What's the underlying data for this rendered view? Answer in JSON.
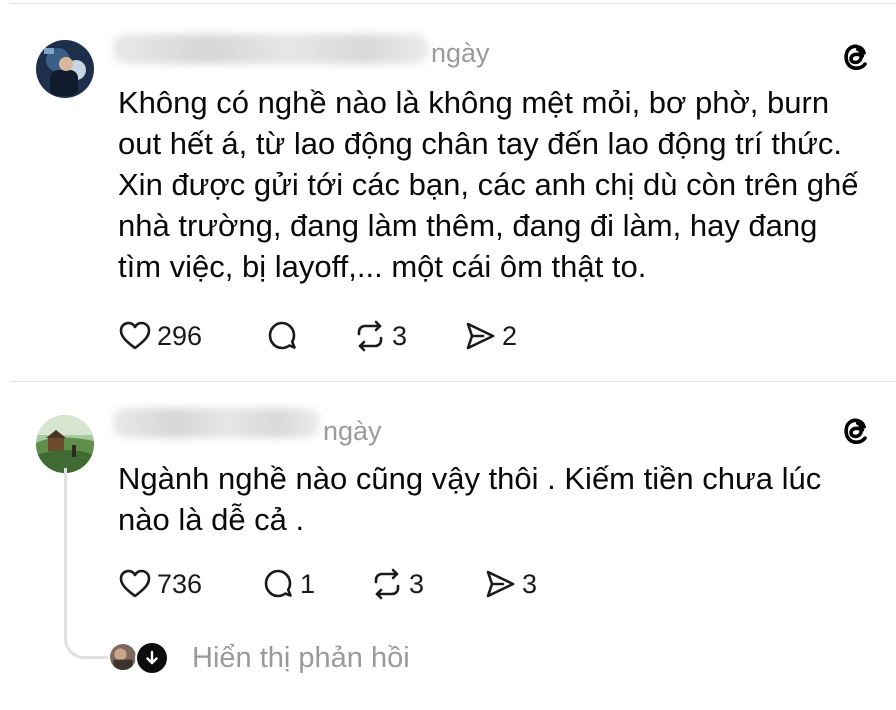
{
  "posts": [
    {
      "time": "ngày",
      "text": "Không có nghề nào là không mệt mỏi, bơ phờ, burn\nout hết á, từ lao động chân tay đến lao động trí thức.\nXin được gửi tới các bạn, các anh chị dù còn trên ghế\nnhà trường, đang làm thêm, đang đi làm, hay đang\ntìm việc, bị layoff,... một cái ôm thật to.",
      "likes": "296",
      "replies": "",
      "reposts": "3",
      "shares": "2"
    },
    {
      "time": "ngày",
      "text": "Ngành nghề nào cũng vậy thôi . Kiếm tiền chưa lúc\nnào là dễ cả .",
      "likes": "736",
      "replies": "1",
      "reposts": "3",
      "shares": "3"
    }
  ],
  "show_replies_label": "Hiển thị phản hồi",
  "icons": {
    "like": "heart-icon",
    "reply": "comment-icon",
    "repost": "repost-icon",
    "share": "share-icon",
    "brand": "threads-logo-icon",
    "expand": "arrow-down-icon"
  },
  "colors": {
    "text": "#0a0a0a",
    "muted": "#9a9a9a",
    "divider": "#e3e3e3",
    "thread_line": "#e0e0e0"
  }
}
